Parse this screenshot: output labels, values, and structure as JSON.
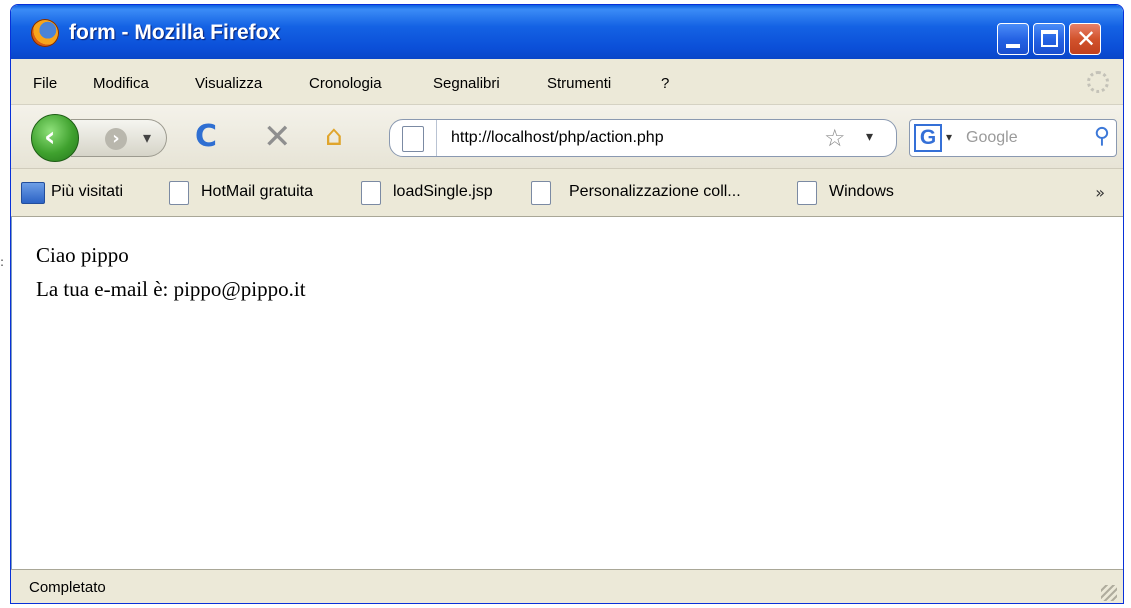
{
  "window": {
    "title": "form - Mozilla Firefox"
  },
  "menu": [
    {
      "label": "File"
    },
    {
      "label": "Modifica"
    },
    {
      "label": "Visualizza"
    },
    {
      "label": "Cronologia"
    },
    {
      "label": "Segnalibri"
    },
    {
      "label": "Strumenti"
    },
    {
      "label": "?"
    }
  ],
  "nav": {
    "url": "http://localhost/php/action.php",
    "search_placeholder": "Google"
  },
  "bookmarks": [
    {
      "label": "Più visitati",
      "icon": "most-visited-icon"
    },
    {
      "label": "HotMail gratuita",
      "icon": "page-icon"
    },
    {
      "label": "loadSingle.jsp",
      "icon": "page-icon"
    },
    {
      "label": "Personalizzazione coll...",
      "icon": "page-icon"
    },
    {
      "label": "Windows",
      "icon": "page-icon"
    }
  ],
  "content": {
    "line1": "Ciao pippo",
    "line2": "La tua e-mail è: pippo@pippo.it"
  },
  "status": {
    "text": "Completato"
  },
  "colors": {
    "titlebar": "#0a5fe0",
    "chrome": "#ece9d8",
    "back_button": "#3fa12e",
    "close_button": "#d2532d"
  }
}
